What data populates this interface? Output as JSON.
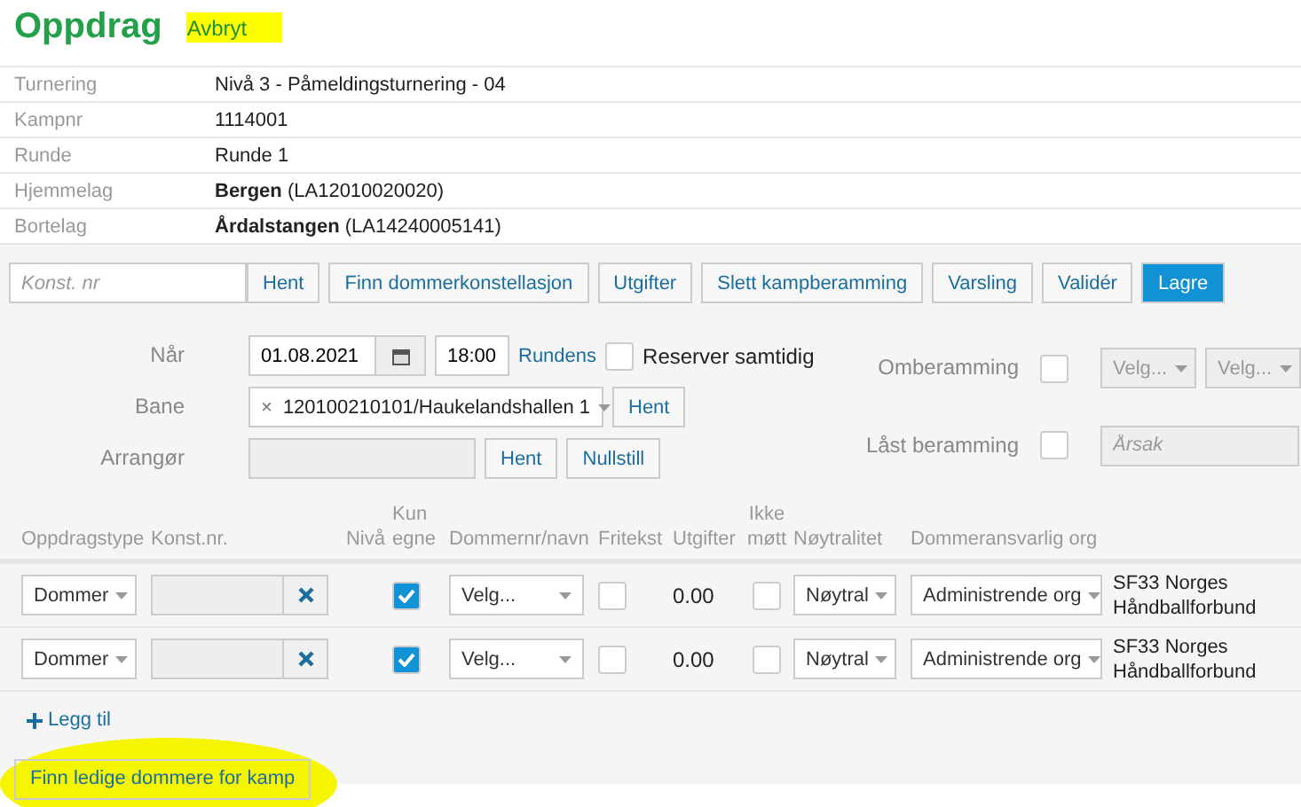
{
  "header": {
    "title": "Oppdrag",
    "cancel_link": "Avbryt",
    "highlighted": true
  },
  "info": [
    {
      "label": "Turnering",
      "value": "Nivå 3 - Påmeldingsturnering - 04"
    },
    {
      "label": "Kampnr",
      "value": "1114001"
    },
    {
      "label": "Runde",
      "value": "Runde 1"
    },
    {
      "label": "Hjemmelag",
      "value": "**Bergen** (LA12010020020)"
    },
    {
      "label": "Bortelag",
      "value": "**Årdalstangen** (LA14240005141)"
    }
  ],
  "toolbar": {
    "search": {
      "placeholder": "Konst. nr"
    },
    "buttons": [
      {
        "label": "Hent",
        "kind": "default"
      },
      {
        "label": "Finn dommerkonstellasjon",
        "kind": "default"
      },
      {
        "label": "Utgifter",
        "kind": "default"
      },
      {
        "label": "Slett kampberamming",
        "kind": "default"
      },
      {
        "label": "Varsling",
        "kind": "default"
      },
      {
        "label": "Validér",
        "kind": "default"
      },
      {
        "label": "Lagre",
        "kind": "primary"
      }
    ]
  },
  "form": {
    "when": {
      "label": "Når",
      "date": "01.08.2021",
      "time": "18:00",
      "link": "Rundens",
      "reserve_label": "Reserver samtidig",
      "reserve_checked": false
    },
    "venue": {
      "label": "Bane",
      "clear": "×",
      "value": "120100210101/Haukelandshallen 1",
      "button": "Hent"
    },
    "organizer": {
      "label": "Arrangør",
      "buttons": [
        "Hent",
        "Nullstill"
      ]
    },
    "rescheduling": {
      "label": "Omberamming",
      "checked": false,
      "selects": [
        "Velg...",
        "Velg..."
      ]
    },
    "locked": {
      "label": "Låst beramming",
      "checked": false,
      "placeholder": "Årsak"
    }
  },
  "table": {
    "columns": [
      "Oppdragstype",
      "Konst.nr.",
      "Nivå",
      "Kun egne",
      "Dommernr/navn",
      "Fritekst",
      "Utgifter",
      "Ikke møtt",
      "Nøytralitet",
      "Dommeransvarlig org"
    ],
    "rows": [
      {
        "type": "Dommer",
        "own_only": true,
        "referee_placeholder": "Velg...",
        "free_text": false,
        "expenses": "0.00",
        "absent": false,
        "neutrality": "Nøytral",
        "responsible": "Administrende org",
        "org": "SF33 Norges Håndballforbund"
      },
      {
        "type": "Dommer",
        "own_only": true,
        "referee_placeholder": "Velg...",
        "free_text": false,
        "expenses": "0.00",
        "absent": false,
        "neutrality": "Nøytral",
        "responsible": "Administrende org",
        "org": "SF33 Norges Håndballforbund"
      }
    ]
  },
  "add_link": "Legg til",
  "find_button": {
    "label": "Finn ledige dommere for kamp",
    "highlighted": true
  }
}
